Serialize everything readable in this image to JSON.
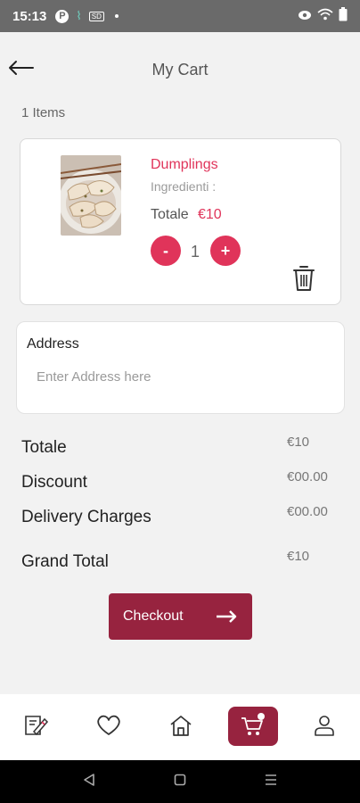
{
  "status_bar": {
    "time": "15:13",
    "icons": [
      "p-badge-icon",
      "teal-signal-icon",
      "sd-card-icon",
      "dot-icon",
      "eye-icon",
      "wifi-icon",
      "battery-icon"
    ],
    "p_badge": "P",
    "sd_badge": "SD"
  },
  "header": {
    "title": "My Cart",
    "back_icon": "arrow-left-icon"
  },
  "cart": {
    "items_count_label": "1 Items",
    "items": [
      {
        "name": "Dumplings",
        "ingredients_label": "Ingredienti :",
        "total_label": "Totale",
        "price": "€10",
        "quantity": "1",
        "minus_label": "-",
        "plus_label": "+",
        "image_icon": "dumplings-photo",
        "delete_icon": "trash-icon"
      }
    ]
  },
  "address": {
    "label": "Address",
    "value": "",
    "placeholder": "Enter Address here"
  },
  "summary": {
    "rows": [
      {
        "label": "Totale",
        "value": "€10"
      },
      {
        "label": "Discount",
        "value": "€00.00"
      },
      {
        "label": "Delivery Charges",
        "value": "€00.00"
      },
      {
        "label": "Grand Total",
        "value": "€10"
      }
    ]
  },
  "checkout": {
    "label": "Checkout",
    "icon": "arrow-right-icon"
  },
  "bottom_nav": {
    "items": [
      {
        "name": "menu",
        "icon": "menu-book-icon",
        "active": false
      },
      {
        "name": "favorites",
        "icon": "heart-icon",
        "active": false
      },
      {
        "name": "home",
        "icon": "home-icon",
        "active": false
      },
      {
        "name": "cart",
        "icon": "cart-icon",
        "active": true
      },
      {
        "name": "profile",
        "icon": "user-icon",
        "active": false
      }
    ]
  },
  "colors": {
    "accent": "#e0345a",
    "primary": "#97233f",
    "background": "#f2f2f2",
    "status_bar": "#6a6a6a"
  }
}
